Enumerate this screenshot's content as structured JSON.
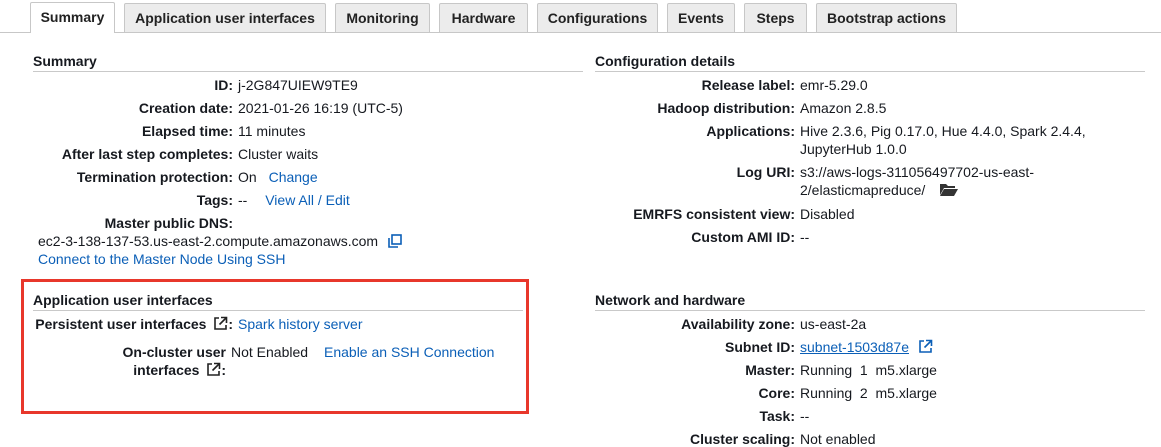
{
  "tabs": [
    {
      "label": "Summary",
      "active": true
    },
    {
      "label": "Application user interfaces",
      "active": false
    },
    {
      "label": "Monitoring",
      "active": false
    },
    {
      "label": "Hardware",
      "active": false
    },
    {
      "label": "Configurations",
      "active": false
    },
    {
      "label": "Events",
      "active": false
    },
    {
      "label": "Steps",
      "active": false
    },
    {
      "label": "Bootstrap actions",
      "active": false
    }
  ],
  "summary": {
    "title": "Summary",
    "id_label": "ID:",
    "id_value": "j-2G847UIEW9TE9",
    "creation_label": "Creation date:",
    "creation_value": "2021-01-26 16:19 (UTC-5)",
    "elapsed_label": "Elapsed time:",
    "elapsed_value": "11 minutes",
    "after_step_label": "After last step completes:",
    "after_step_value": "Cluster waits",
    "termination_label": "Termination protection:",
    "termination_value": "On",
    "termination_link": "Change",
    "tags_label": "Tags:",
    "tags_value": "--",
    "tags_link": "View All / Edit",
    "dns_label": "Master public DNS:",
    "dns_value": "ec2-3-138-137-53.us-east-2.compute.amazonaws.com",
    "ssh_link": "Connect to the Master Node Using SSH"
  },
  "config": {
    "title": "Configuration details",
    "release_label": "Release label:",
    "release_value": "emr-5.29.0",
    "hadoop_label": "Hadoop distribution:",
    "hadoop_value": "Amazon 2.8.5",
    "apps_label": "Applications:",
    "apps_line1": "Hive 2.3.6, Pig 0.17.0, Hue 4.4.0, Spark 2.4.4,",
    "apps_line2": "JupyterHub 1.0.0",
    "log_label": "Log URI:",
    "log_line1": "s3://aws-logs-311056497702-us-east-",
    "log_line2": "2/elasticmapreduce/",
    "emrfs_label": "EMRFS consistent view:",
    "emrfs_value": "Disabled",
    "ami_label": "Custom AMI ID:",
    "ami_value": "--"
  },
  "app_ui": {
    "title": "Application user interfaces",
    "persistent_label": "Persistent user interfaces",
    "persistent_link": "Spark history server",
    "oncluster_label_line1": "On-cluster user",
    "oncluster_label_line2": "interfaces",
    "oncluster_value": "Not Enabled",
    "oncluster_link": "Enable an SSH Connection"
  },
  "network": {
    "title": "Network and hardware",
    "az_label": "Availability zone:",
    "az_value": "us-east-2a",
    "subnet_label": "Subnet ID:",
    "subnet_value": "subnet-1503d87e",
    "master_label": "Master:",
    "master_value": "Running  1  m5.xlarge",
    "core_label": "Core:",
    "core_value": "Running  2  m5.xlarge",
    "task_label": "Task:",
    "task_value": "--",
    "scaling_label": "Cluster scaling:",
    "scaling_value": "Not enabled"
  },
  "colors": {
    "link": "#0b5fb7",
    "highlight": "#e8372b"
  }
}
